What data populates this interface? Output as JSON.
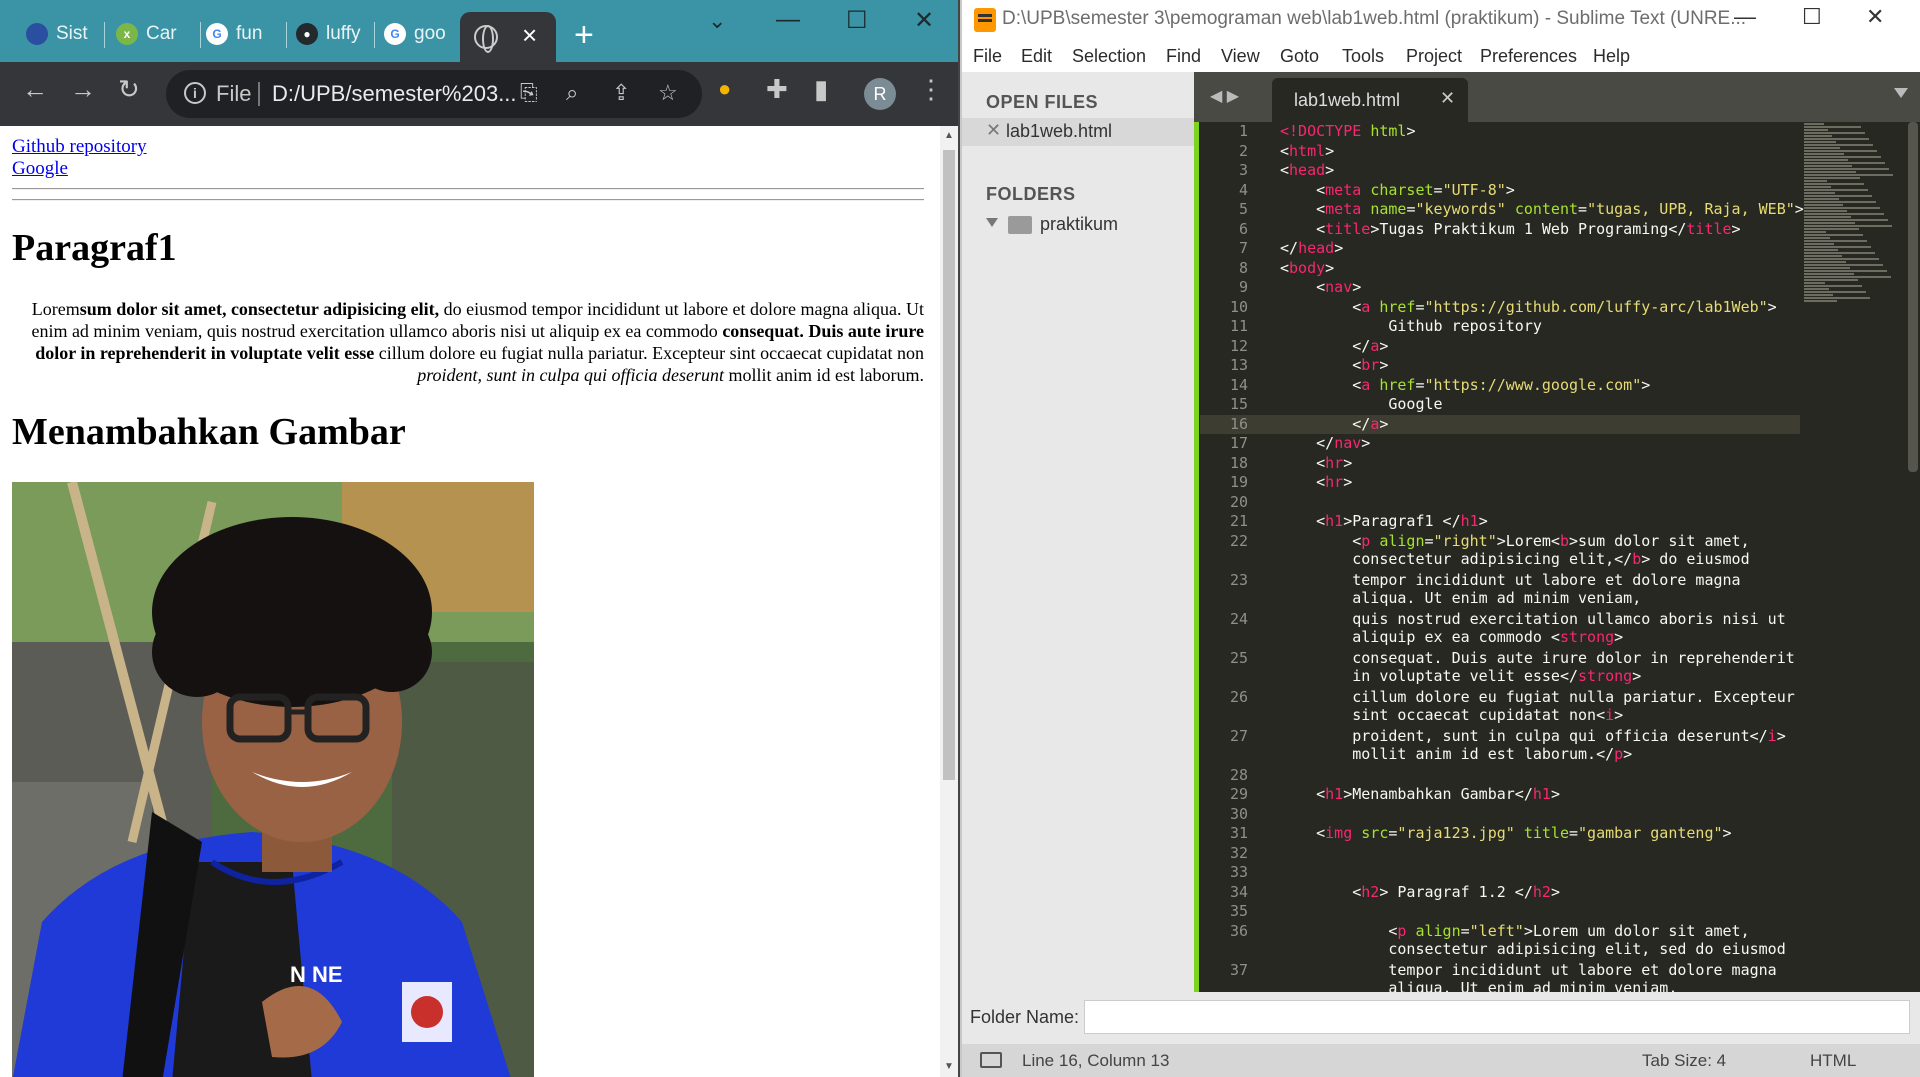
{
  "chrome": {
    "tabs": [
      {
        "label": "Sist",
        "icon": "bank-icon",
        "color": "#2a4fa0"
      },
      {
        "label": "Car",
        "icon": "xampp-icon",
        "color": "#7ab648"
      },
      {
        "label": "fun",
        "icon": "google-icon",
        "color": "#4285f4"
      },
      {
        "label": "luffy",
        "icon": "github-icon",
        "color": "#24292e"
      },
      {
        "label": "goo",
        "icon": "google-icon",
        "color": "#4285f4"
      }
    ],
    "active_tab_close": "×",
    "new_tab": "+",
    "address": {
      "file_label": "File",
      "url": "D:/UPB/semester%203..."
    },
    "avatar_letter": "R"
  },
  "page": {
    "links": [
      "Github repository",
      "Google"
    ],
    "h1_paragraf": "Paragraf1",
    "paragraph": {
      "t1": "Lorem",
      "b1": "sum dolor sit amet, consectetur adipisicing elit,",
      "t2": " do eiusmod tempor incididunt ut labore et dolore magna aliqua. Ut enim ad minim veniam, quis nostrud exercitation ullamco aboris nisi ut aliquip ex ea commodo ",
      "s1": "consequat. Duis aute irure dolor in reprehenderit in voluptate velit esse",
      "t3": " cillum dolore eu fugiat nulla pariatur. Excepteur sint occaecat cupidatat non ",
      "i1": "proident, sunt in culpa qui officia deserunt",
      "t4": " mollit anim id est laborum."
    },
    "h1_gambar": "Menambahkan Gambar",
    "image_title": "gambar ganteng",
    "shirt_text": "N NE"
  },
  "sublime": {
    "title": "D:\\UPB\\semester 3\\pemograman web\\lab1web.html (praktikum) - Sublime Text (UNRE...",
    "menu": [
      "File",
      "Edit",
      "Selection",
      "Find",
      "View",
      "Goto",
      "Tools",
      "Project",
      "Preferences",
      "Help"
    ],
    "sidebar": {
      "open_files_heading": "OPEN FILES",
      "open_file": "lab1web.html",
      "folders_heading": "FOLDERS",
      "folder": "praktikum"
    },
    "tab": "lab1web.html",
    "footer_label": "Folder Name:",
    "status": {
      "position": "Line 16, Column 13",
      "tab_size": "Tab Size: 4",
      "syntax": "HTML"
    },
    "code": [
      {
        "n": "1",
        "html": "<span class='tg'>&lt;!DOCTYPE</span> <span class='at'>html</span>&gt;"
      },
      {
        "n": "2",
        "html": "&lt;<span class='tg'>html</span>&gt;"
      },
      {
        "n": "3",
        "html": "&lt;<span class='tg'>head</span>&gt;"
      },
      {
        "n": "4",
        "html": "    &lt;<span class='tg'>meta</span> <span class='at'>charset</span>=<span class='st'>\"UTF-8\"</span>&gt;"
      },
      {
        "n": "5",
        "html": "    &lt;<span class='tg'>meta</span> <span class='at'>name</span>=<span class='st'>\"keywords\"</span> <span class='at'>content</span>=<span class='st'>\"tugas, UPB, Raja, WEB\"</span>&gt;"
      },
      {
        "n": "6",
        "html": "    &lt;<span class='tg'>title</span>&gt;Tugas Praktikum 1 Web Programing&lt;/<span class='tg'>title</span>&gt;"
      },
      {
        "n": "7",
        "html": "&lt;/<span class='tg'>head</span>&gt;"
      },
      {
        "n": "8",
        "html": "&lt;<span class='tg'>body</span>&gt;"
      },
      {
        "n": "9",
        "html": "    &lt;<span class='tg'>nav</span>&gt;"
      },
      {
        "n": "10",
        "html": "        &lt;<span class='tg'>a</span> <span class='at'>href</span>=<span class='st'>\"https://github.com/luffy-arc/lab1Web\"</span>&gt;"
      },
      {
        "n": "11",
        "html": "            Github repository"
      },
      {
        "n": "12",
        "html": "        &lt;/<span class='tg'>a</span>&gt;"
      },
      {
        "n": "13",
        "html": "        &lt;<span class='tg'>br</span>&gt;"
      },
      {
        "n": "14",
        "html": "        &lt;<span class='tg'>a</span> <span class='at'>href</span>=<span class='st'>\"https://www.google.com\"</span>&gt;"
      },
      {
        "n": "15",
        "html": "            Google"
      },
      {
        "n": "16",
        "html": "        &lt;/<span class='tg'>a</span>&gt;",
        "active": true
      },
      {
        "n": "17",
        "html": "    &lt;/<span class='tg'>nav</span>&gt;"
      },
      {
        "n": "18",
        "html": "    &lt;<span class='tg'>hr</span>&gt;"
      },
      {
        "n": "19",
        "html": "    &lt;<span class='tg'>hr</span>&gt;"
      },
      {
        "n": "20",
        "html": ""
      },
      {
        "n": "21",
        "html": "    &lt;<span class='tg'>h1</span>&gt;Paragraf1 &lt;/<span class='tg'>h1</span>&gt;"
      },
      {
        "n": "22",
        "html": "        &lt;<span class='tg'>p</span> <span class='at'>align</span>=<span class='st'>\"right\"</span>&gt;Lorem&lt;<span class='tg'>b</span>&gt;sum dolor sit amet,\n        consectetur adipisicing elit,&lt;/<span class='tg'>b</span>&gt; do eiusmod",
        "wrap": true
      },
      {
        "n": "23",
        "html": "        tempor incididunt ut labore et dolore magna\n        aliqua. Ut enim ad minim veniam,",
        "wrap": true
      },
      {
        "n": "24",
        "html": "        quis nostrud exercitation ullamco aboris nisi ut\n        aliquip ex ea commodo &lt;<span class='tg'>strong</span>&gt;",
        "wrap": true
      },
      {
        "n": "25",
        "html": "        consequat. Duis aute irure dolor in reprehenderit\n        in voluptate velit esse&lt;/<span class='tg'>strong</span>&gt;",
        "wrap": true
      },
      {
        "n": "26",
        "html": "        cillum dolore eu fugiat nulla pariatur. Excepteur\n        sint occaecat cupidatat non&lt;<span class='tg'>i</span>&gt;",
        "wrap": true
      },
      {
        "n": "27",
        "html": "        proident, sunt in culpa qui officia deserunt&lt;/<span class='tg'>i</span>&gt;\n        mollit anim id est laborum.&lt;/<span class='tg'>p</span>&gt;",
        "wrap": true
      },
      {
        "n": "28",
        "html": ""
      },
      {
        "n": "29",
        "html": "    &lt;<span class='tg'>h1</span>&gt;Menambahkan Gambar&lt;/<span class='tg'>h1</span>&gt;"
      },
      {
        "n": "30",
        "html": ""
      },
      {
        "n": "31",
        "html": "    &lt;<span class='tg'>img</span> <span class='at'>src</span>=<span class='st'>\"raja123.jpg\"</span> <span class='at'>title</span>=<span class='st'>\"gambar ganteng\"</span>&gt;"
      },
      {
        "n": "32",
        "html": ""
      },
      {
        "n": "33",
        "html": ""
      },
      {
        "n": "34",
        "html": "        &lt;<span class='tg'>h2</span>&gt; Paragraf 1.2 &lt;/<span class='tg'>h2</span>&gt;"
      },
      {
        "n": "35",
        "html": ""
      },
      {
        "n": "36",
        "html": "            &lt;<span class='tg'>p</span> <span class='at'>align</span>=<span class='st'>\"left\"</span>&gt;Lorem um dolor sit amet,\n            consectetur adipisicing elit, sed do eiusmod",
        "wrap": true
      },
      {
        "n": "37",
        "html": "            tempor incididunt ut labore et dolore magna\n            aliqua. Ut enim ad minim veniam,",
        "wrap": true
      }
    ]
  }
}
